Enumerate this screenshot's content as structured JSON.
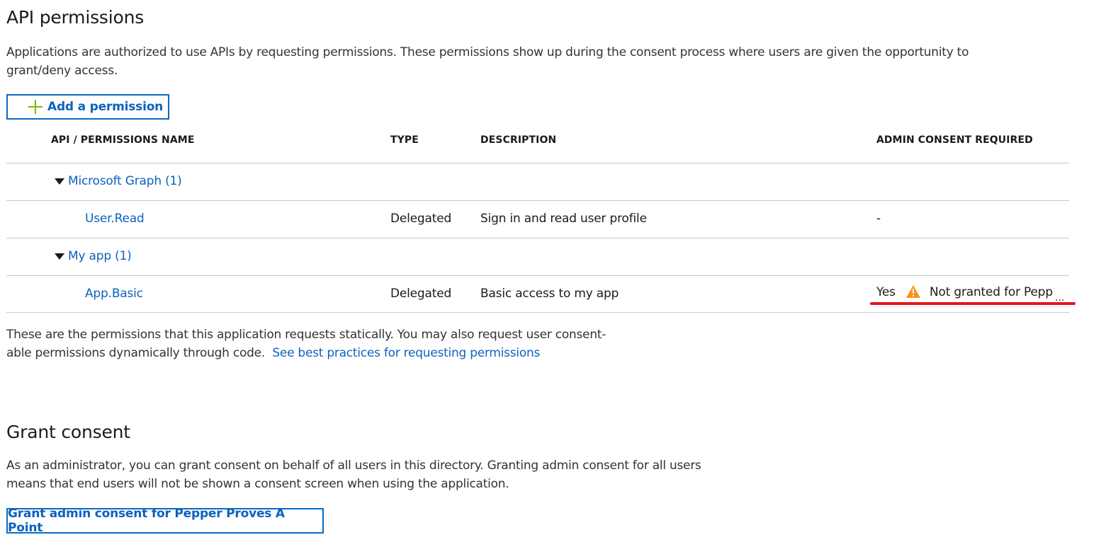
{
  "api_permissions": {
    "title": "API permissions",
    "intro": "Applications are authorized to use APIs by requesting permissions. These permissions show up during the consent process where users are given the opportunity to grant/deny access.",
    "add_button_label": "Add a permission"
  },
  "table": {
    "columns": [
      "API / PERMISSIONS NAME",
      "TYPE",
      "DESCRIPTION",
      "ADMIN CONSENT REQUIRED"
    ],
    "groups": [
      {
        "name": "Microsoft Graph (1)",
        "permissions": [
          {
            "name": "User.Read",
            "type": "Delegated",
            "description": "Sign in and read user profile",
            "admin_consent": "-"
          }
        ]
      },
      {
        "name": "My app (1)",
        "permissions": [
          {
            "name": "App.Basic",
            "type": "Delegated",
            "description": "Basic access to my app",
            "admin_consent": "Yes",
            "status_text": "Not granted for Pepp",
            "status_overflow": "...",
            "status_icon": "warning-icon"
          }
        ]
      }
    ]
  },
  "footnote": {
    "text": "These are the permissions that this application requests statically. You may also request user consent-able permissions dynamically through code.",
    "link_text": "See best practices for requesting permissions"
  },
  "grant_consent": {
    "title": "Grant consent",
    "text": "As an administrator, you can grant consent on behalf of all users in this directory. Granting admin consent for all users means that end users will not be shown a consent screen when using the application.",
    "button_label": "Grant admin consent for Pepper Proves A Point"
  },
  "colors": {
    "link": "#0b62be",
    "plus": "#7db800",
    "warning": "#f7931e",
    "highlight": "#e8141f"
  }
}
